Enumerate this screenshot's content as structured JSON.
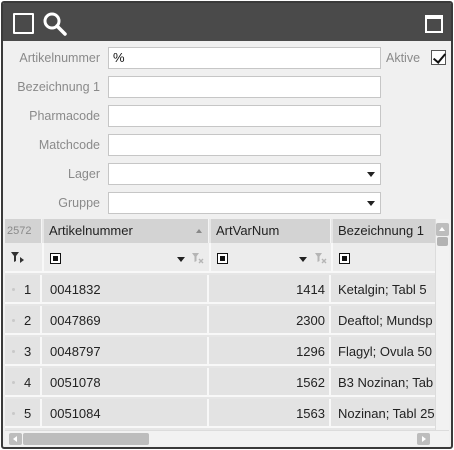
{
  "titlebar": {
    "icons": [
      "select-all-icon",
      "search-icon",
      "maximize-icon"
    ]
  },
  "form": {
    "artikelnummer": {
      "label": "Artikelnummer",
      "value": "%"
    },
    "bezeichnung1": {
      "label": "Bezeichnung 1",
      "value": ""
    },
    "pharmacode": {
      "label": "Pharmacode",
      "value": ""
    },
    "matchcode": {
      "label": "Matchcode",
      "value": ""
    },
    "lager": {
      "label": "Lager",
      "value": ""
    },
    "gruppe": {
      "label": "Gruppe",
      "value": ""
    },
    "aktive": {
      "label": "Aktive",
      "checked": true
    }
  },
  "grid": {
    "record_count": "2572",
    "columns": [
      "Artikelnummer",
      "ArtVarNum",
      "Bezeichnung 1"
    ],
    "rows": [
      {
        "idx": "1",
        "artikelnummer": "0041832",
        "artvarnum": "1414",
        "bezeichnung": "Ketalgin; Tabl 5"
      },
      {
        "idx": "2",
        "artikelnummer": "0047869",
        "artvarnum": "2300",
        "bezeichnung": "Deaftol; Mundsp"
      },
      {
        "idx": "3",
        "artikelnummer": "0048797",
        "artvarnum": "1296",
        "bezeichnung": "Flagyl; Ovula 50"
      },
      {
        "idx": "4",
        "artikelnummer": "0051078",
        "artvarnum": "1562",
        "bezeichnung": "B3 Nozinan; Tab"
      },
      {
        "idx": "5",
        "artikelnummer": "0051084",
        "artvarnum": "1563",
        "bezeichnung": "Nozinan; Tabl 25"
      }
    ]
  },
  "colors": {
    "titlebar": "#4a4a4a",
    "header": "#d3d3d3",
    "row": "#e3e3e3"
  }
}
